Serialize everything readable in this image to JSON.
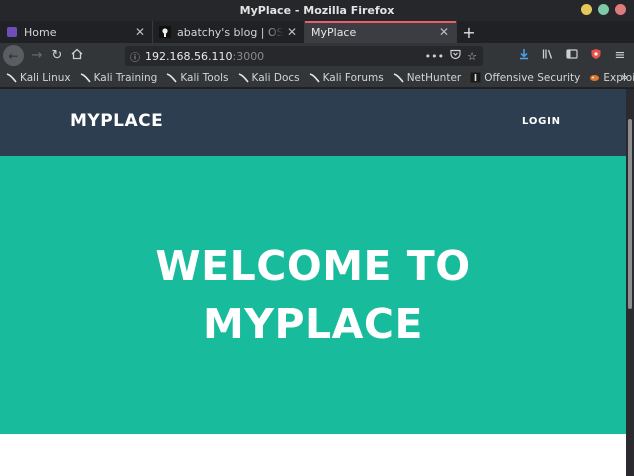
{
  "window": {
    "title": "MyPlace - Mozilla Firefox",
    "colors": {
      "minimize": "#e5c85a",
      "maximize": "#7ec9a8",
      "close": "#e07b7b"
    }
  },
  "tabs": [
    {
      "title": "Home",
      "icon": "purple-square-icon",
      "active": false
    },
    {
      "title": "abatchy's blog | OSCP-like",
      "icon": "blog-favicon-icon",
      "active": false
    },
    {
      "title": "MyPlace",
      "icon": "",
      "active": true
    }
  ],
  "toolbar": {
    "url_host": "192.168.56.110",
    "url_port": ":3000",
    "page_actions_label": "•••"
  },
  "bookmarks": [
    {
      "label": "Kali Linux",
      "icon": "kali-dragon-icon"
    },
    {
      "label": "Kali Training",
      "icon": "kali-dragon-icon"
    },
    {
      "label": "Kali Tools",
      "icon": "kali-dragon-icon"
    },
    {
      "label": "Kali Docs",
      "icon": "kali-dragon-icon"
    },
    {
      "label": "Kali Forums",
      "icon": "kali-dragon-icon"
    },
    {
      "label": "NetHunter",
      "icon": "kali-dragon-icon"
    },
    {
      "label": "Offensive Security",
      "icon": "offsec-icon"
    },
    {
      "label": "Exploit-DB",
      "icon": "exploit-db-icon"
    }
  ],
  "site": {
    "brand": "MYPLACE",
    "login_label": "LOGIN",
    "hero_title": "WELCOME TO MYPLACE",
    "colors": {
      "header": "#2c3e50",
      "hero": "#18bc9c"
    }
  }
}
